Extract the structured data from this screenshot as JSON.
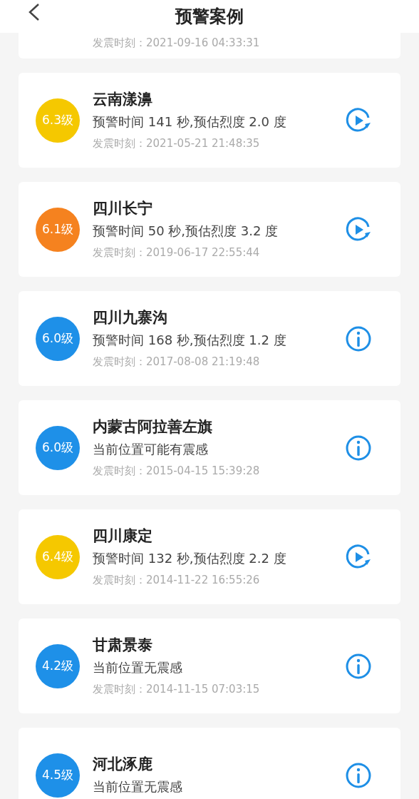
{
  "header": {
    "title": "预警案例"
  },
  "cards": [
    {
      "partial": true,
      "time": "发震时刻：2021-09-16 04:33:31"
    },
    {
      "partial": false,
      "magnitude": "6.3级",
      "color": "#f5c800",
      "place": "云南漾濞",
      "detail": "预警时间 141 秒,预估烈度 2.0 度",
      "time": "发震时刻：2021-05-21 21:48:35",
      "kind": "replay"
    },
    {
      "partial": false,
      "magnitude": "6.1级",
      "color": "#f5821f",
      "place": "四川长宁",
      "detail": "预警时间 50 秒,预估烈度 3.2 度",
      "time": "发震时刻：2019-06-17 22:55:44",
      "kind": "replay"
    },
    {
      "partial": false,
      "magnitude": "6.0级",
      "color": "#1e90e8",
      "place": "四川九寨沟",
      "detail": "预警时间 168 秒,预估烈度 1.2 度",
      "time": "发震时刻：2017-08-08 21:19:48",
      "kind": "info"
    },
    {
      "partial": false,
      "magnitude": "6.0级",
      "color": "#1e90e8",
      "place": "内蒙古阿拉善左旗",
      "detail": "当前位置可能有震感",
      "time": "发震时刻：2015-04-15 15:39:28",
      "kind": "info"
    },
    {
      "partial": false,
      "magnitude": "6.4级",
      "color": "#f5c800",
      "place": "四川康定",
      "detail": "预警时间 132 秒,预估烈度 2.2 度",
      "time": "发震时刻：2014-11-22 16:55:26",
      "kind": "replay"
    },
    {
      "partial": false,
      "magnitude": "4.2级",
      "color": "#1e90e8",
      "place": "甘肃景泰",
      "detail": "当前位置无震感",
      "time": "发震时刻：2014-11-15 07:03:15",
      "kind": "info"
    },
    {
      "partial": false,
      "magnitude": "4.5级",
      "color": "#1e90e8",
      "place": "河北涿鹿",
      "detail": "当前位置无震感",
      "kind": "info"
    }
  ]
}
